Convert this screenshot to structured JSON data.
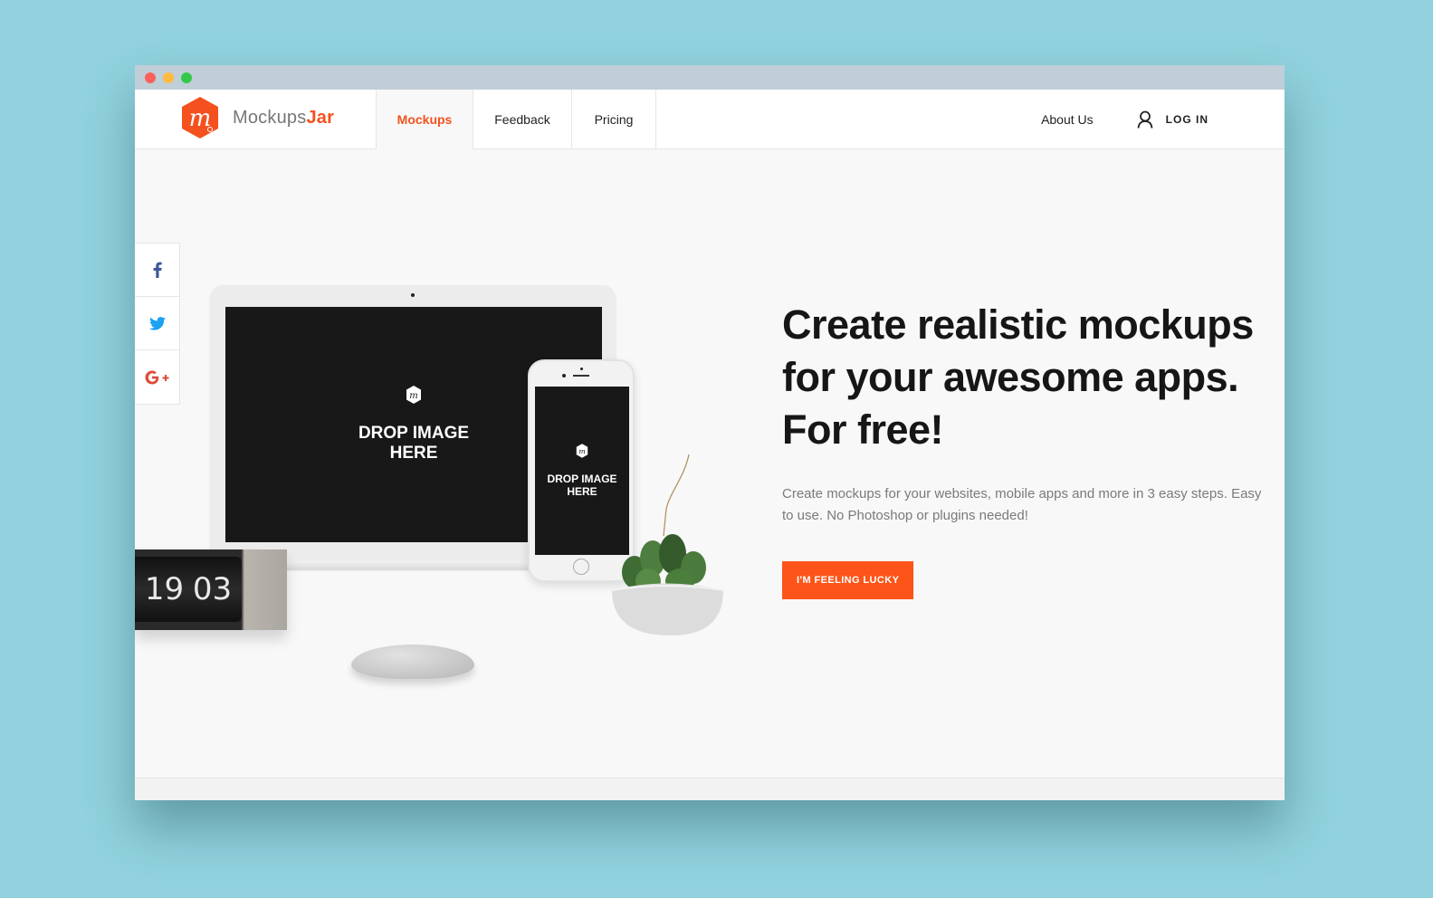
{
  "window": {
    "controls": [
      "close",
      "minimize",
      "maximize"
    ]
  },
  "brand": {
    "name_primary": "Mockups",
    "name_accent": "Jar",
    "logo_icon": "mockupsjar-hexagon-m-icon",
    "accent_color": "#f4511e"
  },
  "nav": {
    "tabs": [
      {
        "label": "Mockups",
        "active": true
      },
      {
        "label": "Feedback",
        "active": false
      },
      {
        "label": "Pricing",
        "active": false
      }
    ],
    "about_label": "About Us",
    "login_label": "LOG IN",
    "login_icon": "user-icon"
  },
  "social": [
    {
      "name": "facebook",
      "icon": "facebook-icon",
      "color": "#3b5998"
    },
    {
      "name": "twitter",
      "icon": "twitter-icon",
      "color": "#1da1f2"
    },
    {
      "name": "google-plus",
      "icon": "google-plus-icon",
      "color": "#dd4b39"
    }
  ],
  "hero": {
    "headline_lines": [
      "Create realistic mockups",
      "for your awesome apps.",
      "For free!"
    ],
    "subtext": "Create mockups for your websites, mobile apps and more in 3 easy steps. Easy to use. No Photoshop or plugins needed!",
    "cta_label": "I'M FEELING LUCKY",
    "cta_color": "#fc5419"
  },
  "scene": {
    "laptop_drop_text_1": "DROP IMAGE",
    "laptop_drop_text_2": "HERE",
    "phone_drop_text_1": "DROP IMAGE",
    "phone_drop_text_2": "HERE",
    "clock_hour": "19",
    "clock_minute": "03"
  }
}
